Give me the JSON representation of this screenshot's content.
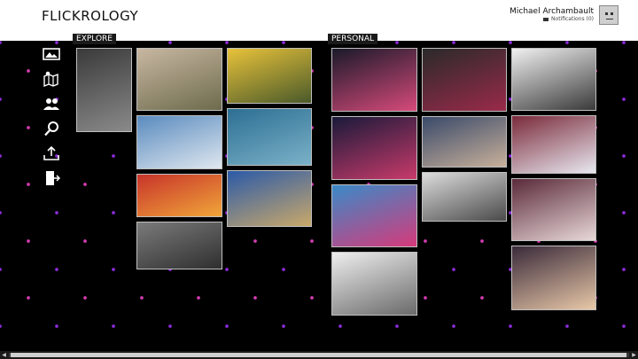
{
  "app": {
    "title": "FLICKROLOGY"
  },
  "user": {
    "name": "Michael Archambault",
    "notifications": "Notifications (0)"
  },
  "nav": [
    {
      "name": "photo-icon"
    },
    {
      "name": "map-icon"
    },
    {
      "name": "people-icon"
    },
    {
      "name": "search-icon"
    },
    {
      "name": "upload-icon"
    },
    {
      "name": "sign-out-icon"
    }
  ],
  "explore": {
    "label": "EXPLORE",
    "photos": [
      {
        "name": "explore-photo-baby-foot",
        "colors": [
          "#3a3a3a",
          "#8a8a8a"
        ]
      },
      {
        "name": "explore-photo-hills",
        "colors": [
          "#c8b7a1",
          "#6d6b4d"
        ]
      },
      {
        "name": "explore-photo-daffodils",
        "colors": [
          "#e8c23a",
          "#4a5a2a"
        ]
      },
      {
        "name": "explore-photo-lighthouse",
        "colors": [
          "#5a8bbf",
          "#dfe7ef"
        ]
      },
      {
        "name": "explore-photo-waves",
        "colors": [
          "#2c6f93",
          "#7bb1c8"
        ]
      },
      {
        "name": "explore-photo-leaves",
        "colors": [
          "#c8342a",
          "#f0a53a"
        ]
      },
      {
        "name": "explore-photo-palace",
        "colors": [
          "#2b5aa8",
          "#c9a86a"
        ]
      },
      {
        "name": "explore-photo-forest",
        "colors": [
          "#7a7a7a",
          "#2f2f2f"
        ]
      }
    ]
  },
  "personal": {
    "label": "PERSONAL",
    "photos": [
      {
        "name": "personal-photo-booth-1",
        "colors": [
          "#1a1a2a",
          "#d64a7a"
        ]
      },
      {
        "name": "personal-photo-booth-2",
        "colors": [
          "#2a2a2a",
          "#9a2a4a"
        ]
      },
      {
        "name": "personal-photo-tablet",
        "colors": [
          "#f0f0f0",
          "#3a3a3a"
        ]
      },
      {
        "name": "personal-photo-booth-3",
        "colors": [
          "#1a1a3a",
          "#c83a6a"
        ]
      },
      {
        "name": "personal-photo-two-men",
        "colors": [
          "#3a4a6a",
          "#c8b09a"
        ]
      },
      {
        "name": "personal-photo-dj-booth",
        "colors": [
          "#7a2a3a",
          "#e8e8f0"
        ]
      },
      {
        "name": "personal-photo-pink-banner",
        "colors": [
          "#3a8ac8",
          "#d63a7a"
        ]
      },
      {
        "name": "personal-photo-group",
        "colors": [
          "#dcdcdc",
          "#4a4a4a"
        ]
      },
      {
        "name": "personal-photo-demo-table",
        "colors": [
          "#5a2a3a",
          "#e8d8d8"
        ]
      },
      {
        "name": "personal-photo-laptop-table",
        "colors": [
          "#eeeeee",
          "#6a6a6a"
        ]
      },
      {
        "name": "personal-photo-light-box",
        "colors": [
          "#3a2a3a",
          "#e8c8a8"
        ]
      }
    ]
  }
}
